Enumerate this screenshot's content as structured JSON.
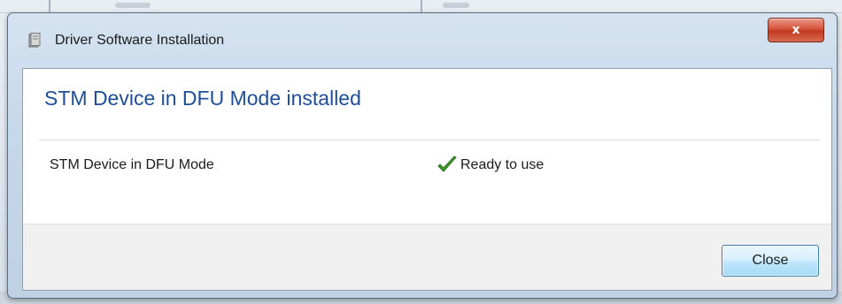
{
  "dialog": {
    "title": "Driver Software Installation",
    "title_icon": "driver-installer-icon",
    "close_glyph": "x",
    "close_x_icon": "close-icon"
  },
  "content": {
    "heading": "STM Device in DFU Mode installed",
    "devices": [
      {
        "name": "STM Device in DFU Mode",
        "status": "Ready to use",
        "status_icon": "checkmark-icon",
        "status_color": "#3f9b2e"
      }
    ]
  },
  "footer": {
    "close_label": "Close"
  },
  "colors": {
    "heading": "#1e4e9a",
    "close_x_bg": "#c23a1f",
    "button_border": "#3c7fb1"
  }
}
